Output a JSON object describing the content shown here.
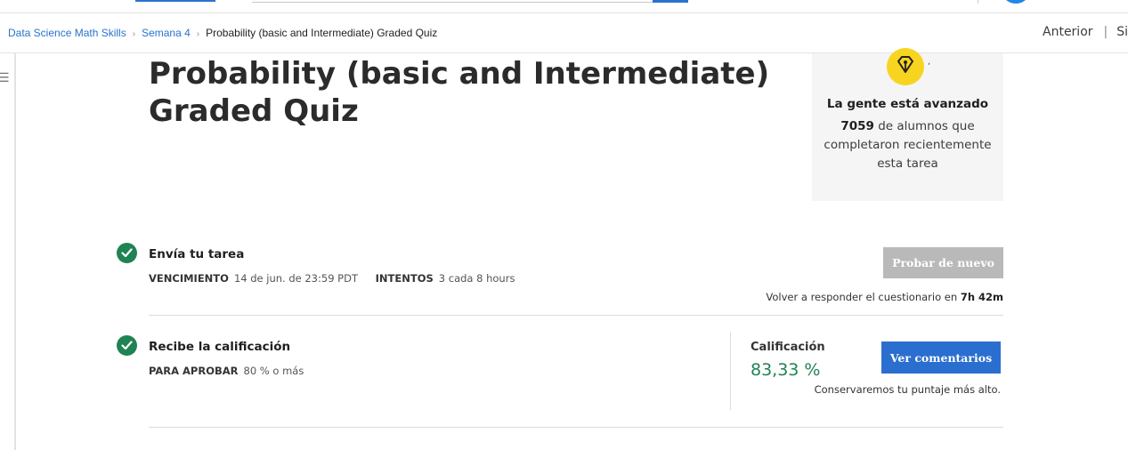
{
  "breadcrumb": {
    "items": [
      "Data Science Math Skills",
      "Semana 4"
    ],
    "current": "Probability (basic and Intermediate) Graded Quiz"
  },
  "pager": {
    "previous": "Anterior",
    "next": "Si"
  },
  "quiz": {
    "title": "Probability (basic and Intermediate) Graded Quiz"
  },
  "info_card": {
    "icon": "lightbulb-pen-icon",
    "heading": "La gente está avanzado",
    "count": "7059",
    "text": "de alumnos que completaron recientemente esta tarea"
  },
  "submit_step": {
    "title": "Envía tu tarea",
    "due_label": "VENCIMIENTO",
    "due_value": "14 de jun. de 23:59 PDT",
    "attempts_label": "INTENTOS",
    "attempts_value": "3 cada 8 hours",
    "retry_button": "Probar de nuevo",
    "retry_note": "Volver a responder el cuestionario en",
    "retry_time": "7h 42m"
  },
  "grade_step": {
    "title": "Recibe la calificación",
    "pass_label": "PARA APROBAR",
    "pass_value": "80 % o más",
    "grade_label": "Calificación",
    "grade_value": "83,33 %",
    "feedback_button": "Ver comentarios",
    "keep_note": "Conservaremos tu puntaje más alto."
  },
  "colors": {
    "accent": "#2a6fcf",
    "success": "#1f8354",
    "disabled": "#b9b9b9",
    "badge": "#f7d420"
  }
}
